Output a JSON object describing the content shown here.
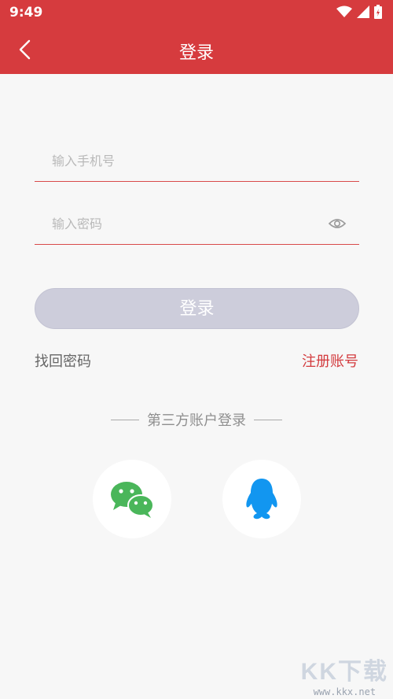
{
  "status_bar": {
    "time": "9:49"
  },
  "app_bar": {
    "title": "登录"
  },
  "form": {
    "phone_placeholder": "输入手机号",
    "password_placeholder": "输入密码",
    "login_label": "登录",
    "forgot_label": "找回密码",
    "register_label": "注册账号"
  },
  "third_party": {
    "title": "第三方账户登录",
    "providers": [
      {
        "name": "wechat-icon",
        "color": "#4ab65a"
      },
      {
        "name": "qq-icon",
        "color": "#1296f0"
      }
    ]
  },
  "watermark": {
    "brand": "KK下载",
    "url": "www.kkx.net"
  },
  "colors": {
    "accent": "#d63b3e",
    "button_disabled": "#cdcddb",
    "background": "#f7f7f7"
  }
}
